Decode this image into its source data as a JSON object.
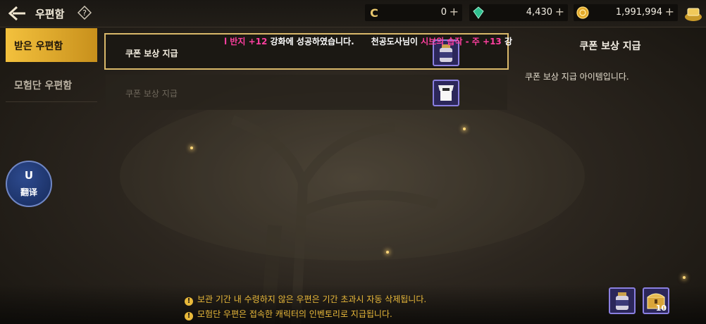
{
  "header": {
    "title": "우편함",
    "help_label": "?",
    "currencies": [
      {
        "icon": "c-coin-icon",
        "value": "0"
      },
      {
        "icon": "green-crystal-icon",
        "value": "4,430"
      },
      {
        "icon": "gold-coin-icon",
        "value": "1,991,994"
      }
    ]
  },
  "tabs": {
    "received": "받은 우편함",
    "guild": "모험단 우편함"
  },
  "translate_button": {
    "icon_text": "U",
    "label": "翻译"
  },
  "mail_list": [
    {
      "label": "쿠폰 보상 지급",
      "item_icon": "potion-jar-icon",
      "selected": true
    },
    {
      "label": "쿠폰 보상 지급",
      "item_icon": "armor-chest-icon",
      "selected": false
    }
  ],
  "notice": {
    "part1": "l 반지 ",
    "part2": "+12",
    "part3": " 강화에 성공하였습니다.",
    "part4": "천공도사님이 ",
    "part5": "시브의 습작 - 주 +13",
    "part6": " 강"
  },
  "detail": {
    "title": "쿠폰 보상 지급",
    "description": "쿠폰 보상 지급 아이템입니다."
  },
  "footer": {
    "note1": "보관 기간 내 수령하지 않은 우편은 기간 초과시 자동 삭제됩니다.",
    "note2": "모험단 우편은 접속한 캐릭터의 인벤토리로 지급됩니다.",
    "warn_symbol": "!"
  },
  "rewards": [
    {
      "icon": "potion-jar-icon",
      "quantity": ""
    },
    {
      "icon": "treasure-chest-icon",
      "quantity": "10"
    }
  ],
  "colors": {
    "accent": "#f3c13d",
    "selected_border": "#d9b86a",
    "warning": "#e9b93a",
    "highlight": "#ff3fa0"
  }
}
